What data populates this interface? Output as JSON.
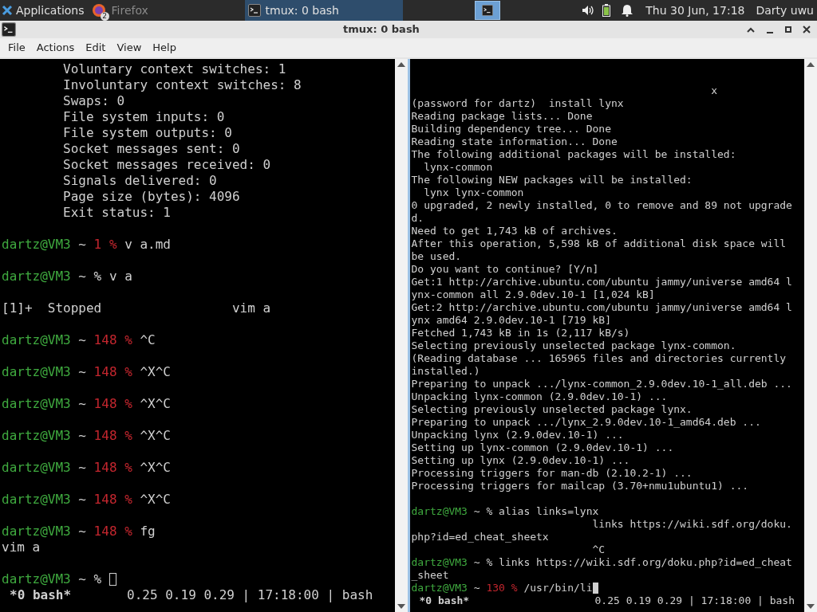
{
  "taskbar": {
    "menu": "Applications",
    "tasks": [
      {
        "label": "Firefox",
        "badge": "2",
        "kind": "browser",
        "active": false,
        "minimized": true
      },
      {
        "label": "tmux: 0 bash",
        "kind": "terminal",
        "active": true,
        "minimized": false
      }
    ],
    "workspace": {
      "selected": true
    },
    "clock": "Thu 30 Jun, 17:18",
    "user": "Darty uwu"
  },
  "window": {
    "title": "tmux: 0 bash"
  },
  "menu": [
    "File",
    "Actions",
    "Edit",
    "View",
    "Help"
  ],
  "panes": [
    {
      "active": false,
      "lines": [
        {
          "kind": "text",
          "text": "        Voluntary context switches: 1"
        },
        {
          "kind": "text",
          "text": "        Involuntary context switches: 8"
        },
        {
          "kind": "text",
          "text": "        Swaps: 0"
        },
        {
          "kind": "text",
          "text": "        File system inputs: 0"
        },
        {
          "kind": "text",
          "text": "        File system outputs: 0"
        },
        {
          "kind": "text",
          "text": "        Socket messages sent: 0"
        },
        {
          "kind": "text",
          "text": "        Socket messages received: 0"
        },
        {
          "kind": "text",
          "text": "        Signals delivered: 0"
        },
        {
          "kind": "text",
          "text": "        Page size (bytes): 4096"
        },
        {
          "kind": "text",
          "text": "        Exit status: 1"
        },
        {
          "kind": "blank"
        },
        {
          "kind": "prompt",
          "user": "dartz@VM3",
          "dir": "~",
          "code": "1",
          "sign": "%",
          "command": "v a.md"
        },
        {
          "kind": "blank"
        },
        {
          "kind": "prompt",
          "user": "dartz@VM3",
          "dir": "~",
          "sign": "%",
          "command": "v a"
        },
        {
          "kind": "blank"
        },
        {
          "kind": "text",
          "text": "[1]+  Stopped                 vim a"
        },
        {
          "kind": "blank"
        },
        {
          "kind": "prompt",
          "user": "dartz@VM3",
          "dir": "~",
          "code": "148",
          "sign": "%",
          "command": "^C"
        },
        {
          "kind": "blank"
        },
        {
          "kind": "prompt",
          "user": "dartz@VM3",
          "dir": "~",
          "code": "148",
          "sign": "%",
          "command": "^X^C"
        },
        {
          "kind": "blank"
        },
        {
          "kind": "prompt",
          "user": "dartz@VM3",
          "dir": "~",
          "code": "148",
          "sign": "%",
          "command": "^X^C"
        },
        {
          "kind": "blank"
        },
        {
          "kind": "prompt",
          "user": "dartz@VM3",
          "dir": "~",
          "code": "148",
          "sign": "%",
          "command": "^X^C"
        },
        {
          "kind": "blank"
        },
        {
          "kind": "prompt",
          "user": "dartz@VM3",
          "dir": "~",
          "code": "148",
          "sign": "%",
          "command": "^X^C"
        },
        {
          "kind": "blank"
        },
        {
          "kind": "prompt",
          "user": "dartz@VM3",
          "dir": "~",
          "code": "148",
          "sign": "%",
          "command": "^X^C"
        },
        {
          "kind": "blank"
        },
        {
          "kind": "prompt",
          "user": "dartz@VM3",
          "dir": "~",
          "code": "148",
          "sign": "%",
          "command": "fg"
        },
        {
          "kind": "text",
          "text": "vim a"
        },
        {
          "kind": "blank"
        },
        {
          "kind": "prompt",
          "user": "dartz@VM3",
          "dir": "~",
          "sign": "%",
          "cursor": true
        }
      ],
      "status": {
        "session": "*0 bash*",
        "info": "0.25 0.19 0.29 | 17:18:00 | bash"
      }
    },
    {
      "active": true,
      "lines": [
        {
          "kind": "blank"
        },
        {
          "kind": "blank"
        },
        {
          "kind": "text",
          "text": "                                                x"
        },
        {
          "kind": "text",
          "text": "(password for dartz)  install lynx"
        },
        {
          "kind": "text",
          "text": "Reading package lists... Done"
        },
        {
          "kind": "text",
          "text": "Building dependency tree... Done"
        },
        {
          "kind": "text",
          "text": "Reading state information... Done"
        },
        {
          "kind": "text",
          "text": "The following additional packages will be installed:"
        },
        {
          "kind": "text",
          "text": "  lynx-common"
        },
        {
          "kind": "text",
          "text": "The following NEW packages will be installed:"
        },
        {
          "kind": "text",
          "text": "  lynx lynx-common"
        },
        {
          "kind": "text",
          "text": "0 upgraded, 2 newly installed, 0 to remove and 89 not upgrade"
        },
        {
          "kind": "text",
          "text": "d."
        },
        {
          "kind": "text",
          "text": "Need to get 1,743 kB of archives."
        },
        {
          "kind": "text",
          "text": "After this operation, 5,598 kB of additional disk space will"
        },
        {
          "kind": "text",
          "text": "be used."
        },
        {
          "kind": "text",
          "text": "Do you want to continue? [Y/n]"
        },
        {
          "kind": "text",
          "text": "Get:1 http://archive.ubuntu.com/ubuntu jammy/universe amd64 l"
        },
        {
          "kind": "text",
          "text": "ynx-common all 2.9.0dev.10-1 [1,024 kB]"
        },
        {
          "kind": "text",
          "text": "Get:2 http://archive.ubuntu.com/ubuntu jammy/universe amd64 l"
        },
        {
          "kind": "text",
          "text": "ynx amd64 2.9.0dev.10-1 [719 kB]"
        },
        {
          "kind": "text",
          "text": "Fetched 1,743 kB in 1s (2,117 kB/s)"
        },
        {
          "kind": "text",
          "text": "Selecting previously unselected package lynx-common."
        },
        {
          "kind": "text",
          "text": "(Reading database ... 165965 files and directories currently"
        },
        {
          "kind": "text",
          "text": "installed.)"
        },
        {
          "kind": "text",
          "text": "Preparing to unpack .../lynx-common_2.9.0dev.10-1_all.deb ..."
        },
        {
          "kind": "text",
          "text": "Unpacking lynx-common (2.9.0dev.10-1) ..."
        },
        {
          "kind": "text",
          "text": "Selecting previously unselected package lynx."
        },
        {
          "kind": "text",
          "text": "Preparing to unpack .../lynx_2.9.0dev.10-1_amd64.deb ..."
        },
        {
          "kind": "text",
          "text": "Unpacking lynx (2.9.0dev.10-1) ..."
        },
        {
          "kind": "text",
          "text": "Setting up lynx-common (2.9.0dev.10-1) ..."
        },
        {
          "kind": "text",
          "text": "Setting up lynx (2.9.0dev.10-1) ..."
        },
        {
          "kind": "text",
          "text": "Processing triggers for man-db (2.10.2-1) ..."
        },
        {
          "kind": "text",
          "text": "Processing triggers for mailcap (3.70+nmu1ubuntu1) ..."
        },
        {
          "kind": "blank"
        },
        {
          "kind": "prompt",
          "user": "dartz@VM3",
          "dir": "~",
          "sign": "%",
          "command": "alias links=lynx"
        },
        {
          "kind": "text",
          "text": "                             links https://wiki.sdf.org/doku."
        },
        {
          "kind": "text",
          "text": "php?id=ed_cheat_sheetx"
        },
        {
          "kind": "text",
          "text": "                             ^C"
        },
        {
          "kind": "prompt",
          "user": "dartz@VM3",
          "dir": "~",
          "sign": "%",
          "command": "links https://wiki.sdf.org/doku.php?id=ed_cheat"
        },
        {
          "kind": "text",
          "text": "_sheet"
        },
        {
          "kind": "prompt",
          "user": "dartz@VM3",
          "dir": "~",
          "code": "130",
          "sign": "%",
          "command": "/usr/bin/li",
          "cursor": true
        }
      ],
      "status": {
        "session": "*0 bash*",
        "info": "0.25 0.19 0.29 | 17:18:00 | bash"
      }
    }
  ]
}
